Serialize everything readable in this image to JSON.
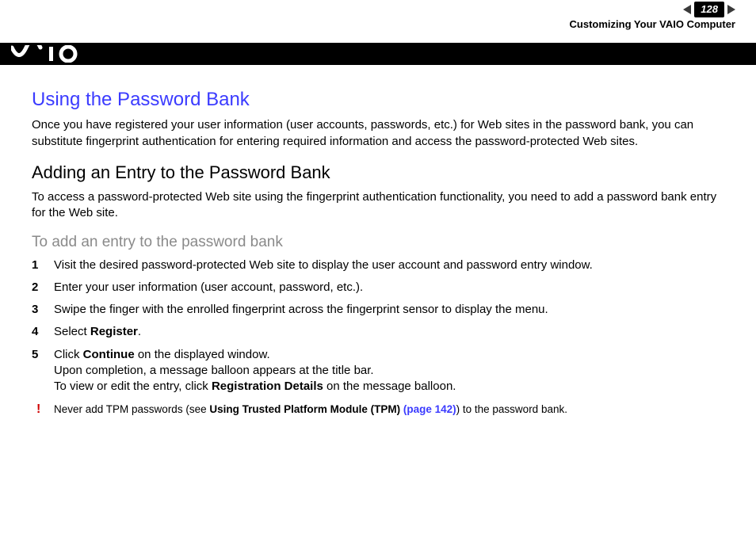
{
  "header": {
    "page_number": "128",
    "breadcrumb": "Customizing Your VAIO Computer"
  },
  "h1": "Using the Password Bank",
  "p1": "Once you have registered your user information (user accounts, passwords, etc.) for Web sites in the password bank, you can substitute fingerprint authentication for entering required information and access the password-protected Web sites.",
  "h2": "Adding an Entry to the Password Bank",
  "p2": "To access a password-protected Web site using the fingerprint authentication functionality, you need to add a password bank entry for the Web site.",
  "h3": "To add an entry to the password bank",
  "steps": [
    "Visit the desired password-protected Web site to display the user account and password entry window.",
    "Enter your user information (user account, password, etc.).",
    "Swipe the finger with the enrolled fingerprint across the fingerprint sensor to display the menu."
  ],
  "step4_pre": "Select ",
  "step4_bold": "Register",
  "step4_post": ".",
  "step5_pre": "Click ",
  "step5_bold1": "Continue",
  "step5_mid1": " on the displayed window.",
  "step5_line2": "Upon completion, a message balloon appears at the title bar.",
  "step5_line3a": "To view or edit the entry, click ",
  "step5_bold2": "Registration Details",
  "step5_line3b": " on the message balloon.",
  "note_bang": "!",
  "note_pre": "Never add TPM passwords (see ",
  "note_bold": "Using Trusted Platform Module (TPM) ",
  "note_link": "(page 142)",
  "note_post": ") to the password bank."
}
